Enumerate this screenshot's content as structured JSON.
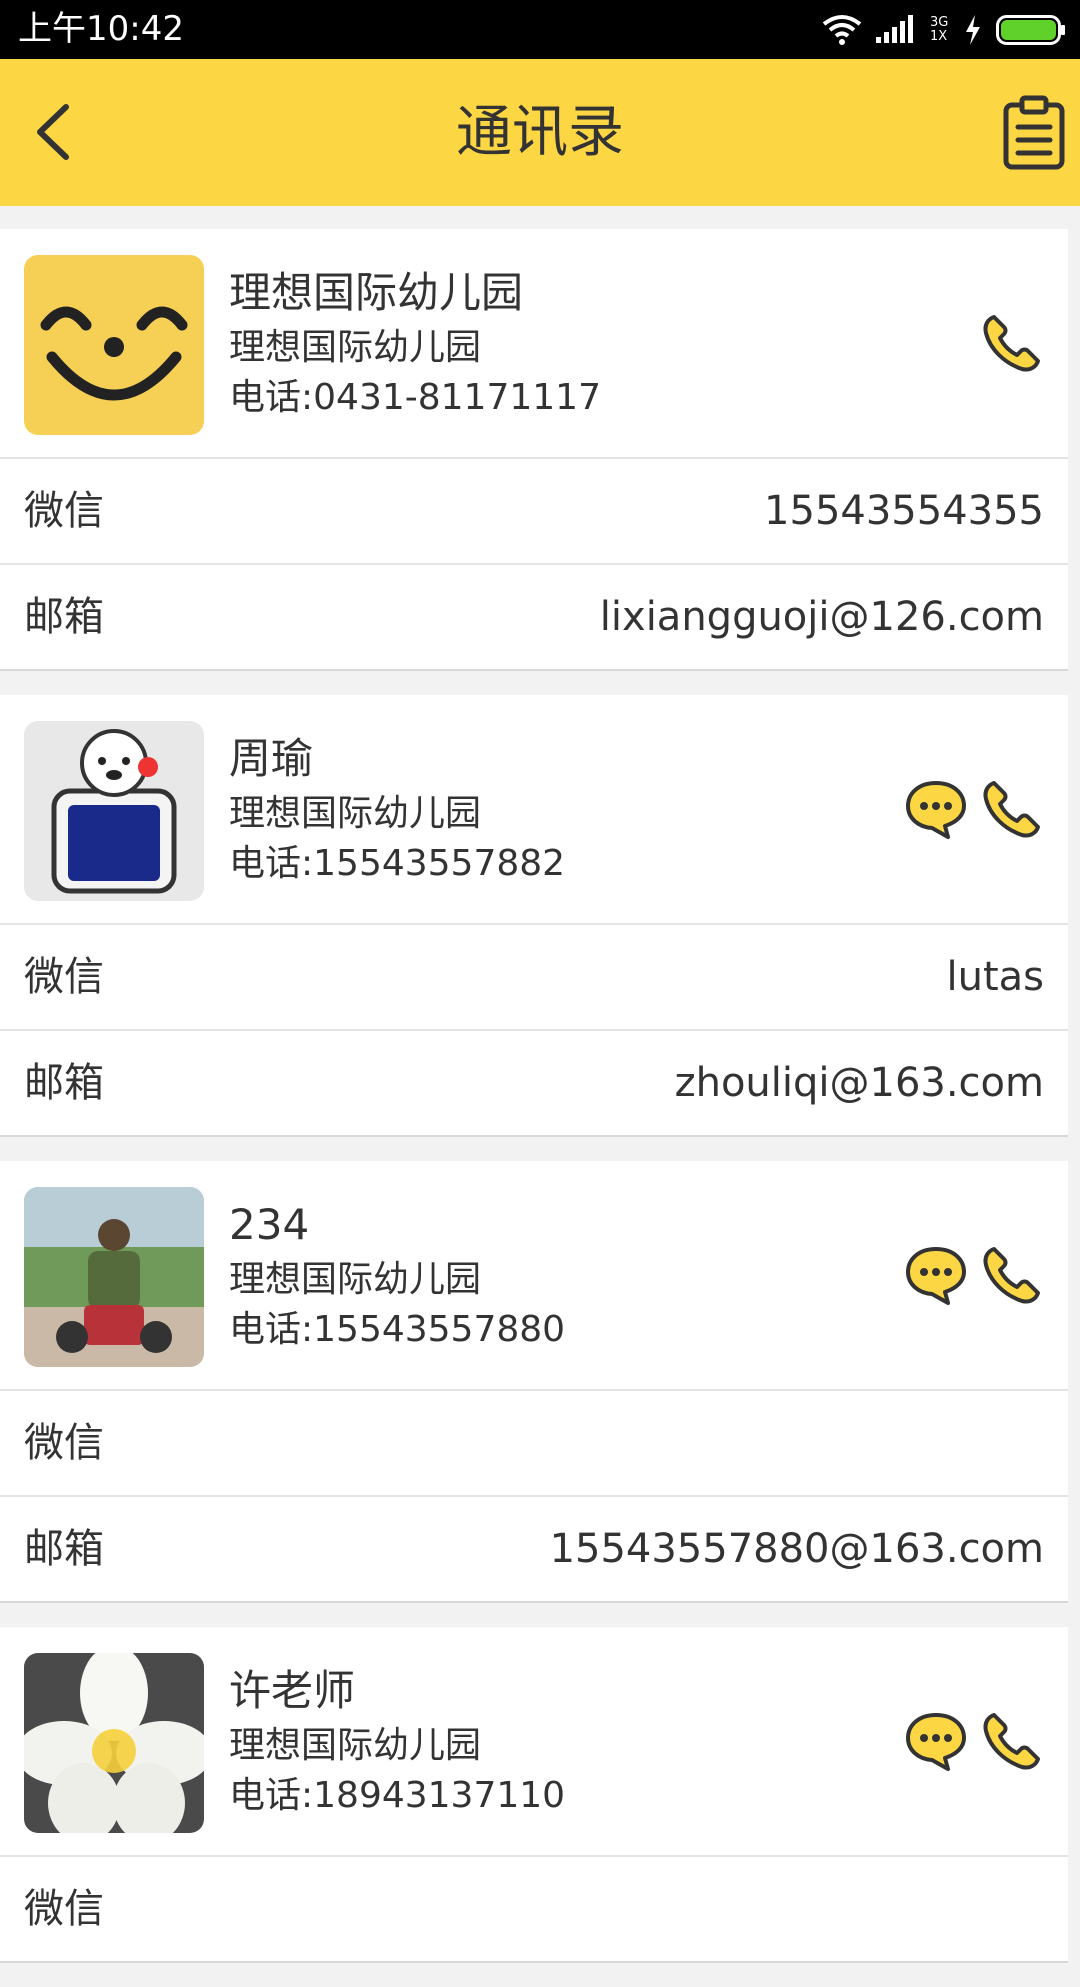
{
  "status_bar": {
    "time": "上午10:42",
    "network": "3G 1X"
  },
  "header": {
    "title": "通讯录"
  },
  "labels": {
    "wechat": "微信",
    "email": "邮箱"
  },
  "contacts": [
    {
      "name": "理想国际幼儿园",
      "org": "理想国际幼儿园",
      "phone": "电话:0431-81171117",
      "wechat": "15543554355",
      "email": "lixiangguoji@126.com",
      "has_message": false
    },
    {
      "name": "周瑜",
      "org": "理想国际幼儿园",
      "phone": "电话:15543557882",
      "wechat": "lutas",
      "email": "zhouliqi@163.com",
      "has_message": true
    },
    {
      "name": "234",
      "org": "理想国际幼儿园",
      "phone": "电话:15543557880",
      "wechat": "",
      "email": "15543557880@163.com",
      "has_message": true
    },
    {
      "name": "许老师",
      "org": "理想国际幼儿园",
      "phone": "电话:18943137110",
      "wechat": "",
      "email": "",
      "has_message": true
    }
  ],
  "colors": {
    "accent": "#fcd643",
    "text": "#333333",
    "divider": "#e3e3e3",
    "background": "#f2f2f2"
  }
}
